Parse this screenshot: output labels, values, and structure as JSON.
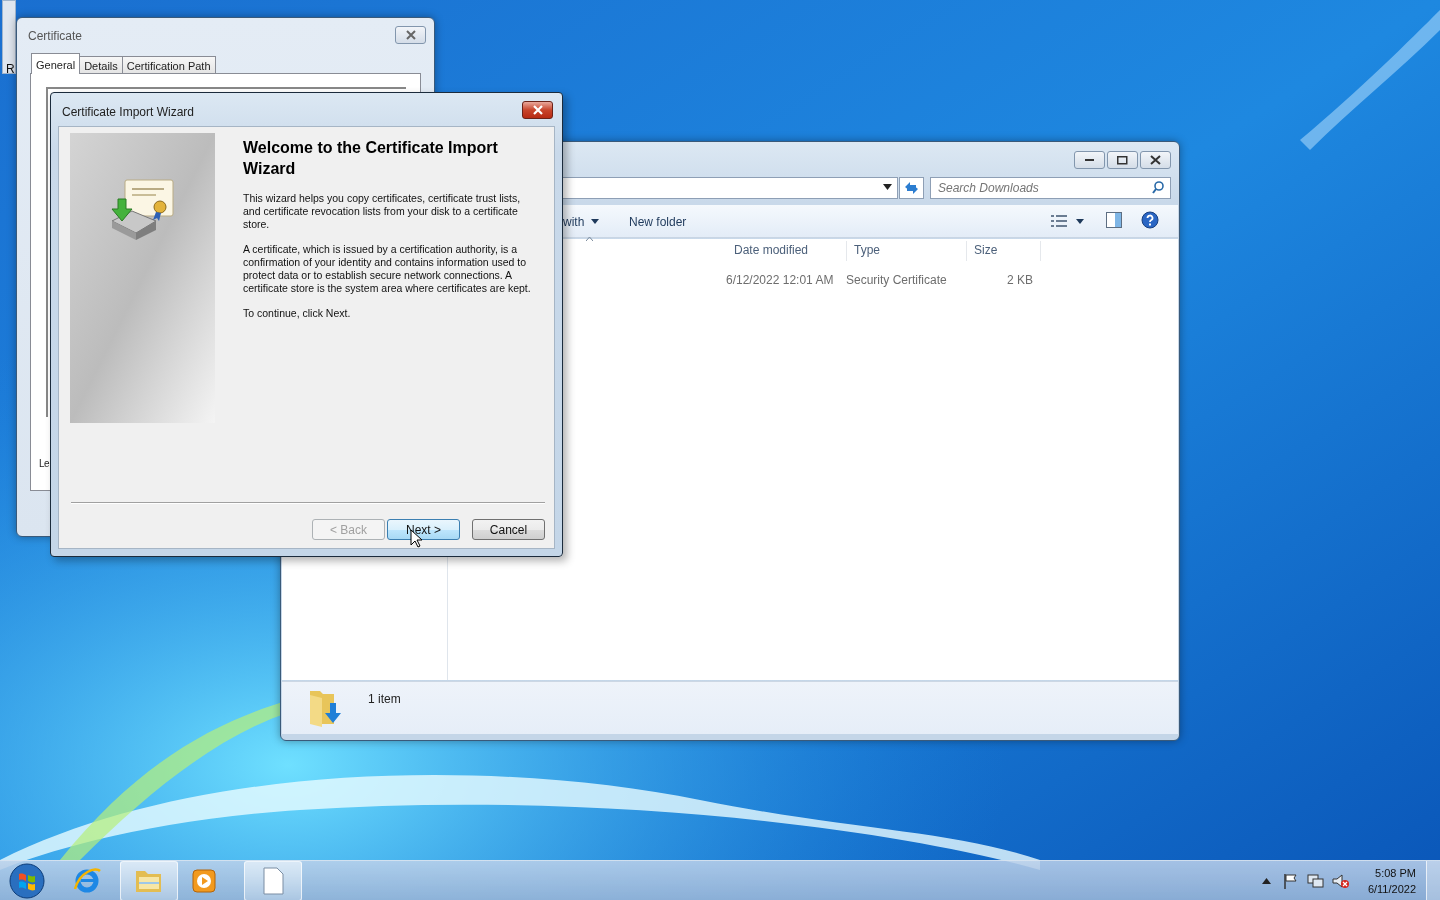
{
  "desktop_icon": {
    "label": "R"
  },
  "certificate_window": {
    "title": "Certificate",
    "tabs": [
      {
        "label": "General",
        "selected": true
      },
      {
        "label": "Details",
        "selected": false
      },
      {
        "label": "Certification Path",
        "selected": false
      }
    ],
    "partial_text": "Le"
  },
  "wizard": {
    "title": "Certificate Import Wizard",
    "heading": "Welcome to the Certificate Import Wizard",
    "paragraphs": [
      "This wizard helps you copy certificates, certificate trust lists, and certificate revocation lists from your disk to a certificate store.",
      "A certificate, which is issued by a certification authority, is a confirmation of your identity and contains information used to protect data or to establish secure network connections. A certificate store is the system area where certificates are kept.",
      "To continue, click Next."
    ],
    "buttons": [
      {
        "label": "< Back",
        "disabled": true,
        "hovered": false
      },
      {
        "label": "Next >",
        "disabled": false,
        "hovered": true
      },
      {
        "label": "Cancel",
        "disabled": false,
        "hovered": false
      }
    ]
  },
  "explorer": {
    "search": {
      "placeholder": "Search Downloads"
    },
    "toolbar": [
      "with",
      "New folder"
    ],
    "columns": [
      "Date modified",
      "Type",
      "Size"
    ],
    "rows": [
      {
        "date_modified": "6/12/2022 12:01 AM",
        "type": "Security Certificate",
        "size": "2 KB"
      }
    ],
    "status": "1 item"
  },
  "taskbar": {
    "items": [
      {
        "kind": "browser",
        "running": false
      },
      {
        "kind": "folder",
        "running": true
      },
      {
        "kind": "media",
        "running": false
      },
      {
        "kind": "document",
        "running": true
      }
    ],
    "time": "5:08 PM",
    "date": "6/11/2022"
  }
}
